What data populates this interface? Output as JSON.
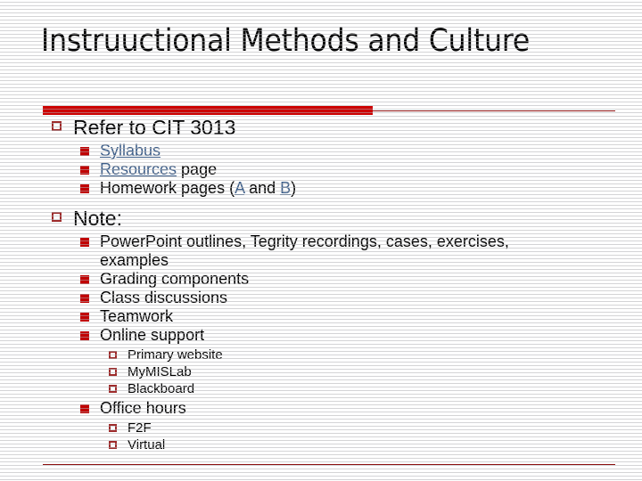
{
  "slide": {
    "title": "Instruuctional Methods and Culture",
    "accent_color": "#CC0000",
    "rule_color": "#8C1010",
    "bullet_hollow_color": "#9E2B2B",
    "bullet_filled_color": "#C00000",
    "link_color": "#3E5F8A",
    "text_color": "#000000",
    "background_color": "#FFFFFF"
  },
  "outline": {
    "item_refer": {
      "level": 1,
      "bullet": "hollow-square-bullet",
      "text": "Refer to CIT 3013"
    },
    "item_syllabus": {
      "level": 2,
      "bullet": "filled-square-bullet",
      "link_text": "Syllabus"
    },
    "item_resources": {
      "level": 2,
      "bullet": "filled-square-bullet",
      "link_text": "Resources",
      "trailing_text": " page"
    },
    "item_homework": {
      "level": 2,
      "bullet": "filled-square-bullet",
      "lead_text": "Homework pages (",
      "link_a": "A",
      "mid_text": " and ",
      "link_b": "B",
      "tail_text": ")"
    },
    "item_note": {
      "level": 1,
      "bullet": "hollow-square-bullet",
      "text": "Note:"
    },
    "item_powerpoint": {
      "level": 2,
      "bullet": "filled-square-bullet",
      "text": "PowerPoint outlines, Tegrity recordings, cases, exercises, examples"
    },
    "item_grading": {
      "level": 2,
      "bullet": "filled-square-bullet",
      "text": "Grading components"
    },
    "item_class_discussions": {
      "level": 2,
      "bullet": "filled-square-bullet",
      "text": "Class discussions"
    },
    "item_teamwork": {
      "level": 2,
      "bullet": "filled-square-bullet",
      "text": "Teamwork"
    },
    "item_online_support": {
      "level": 2,
      "bullet": "filled-square-bullet",
      "text": "Online support"
    },
    "item_primary_website": {
      "level": 3,
      "bullet": "hollow-square-bullet",
      "text": "Primary website"
    },
    "item_mymislab": {
      "level": 3,
      "bullet": "hollow-square-bullet",
      "text": "MyMISLab"
    },
    "item_blackboard": {
      "level": 3,
      "bullet": "hollow-square-bullet",
      "text": "Blackboard"
    },
    "item_office_hours": {
      "level": 2,
      "bullet": "filled-square-bullet",
      "text": "Office hours"
    },
    "item_f2f": {
      "level": 3,
      "bullet": "hollow-square-bullet",
      "text": "F2F"
    },
    "item_virtual": {
      "level": 3,
      "bullet": "hollow-square-bullet",
      "text": "Virtual"
    }
  }
}
